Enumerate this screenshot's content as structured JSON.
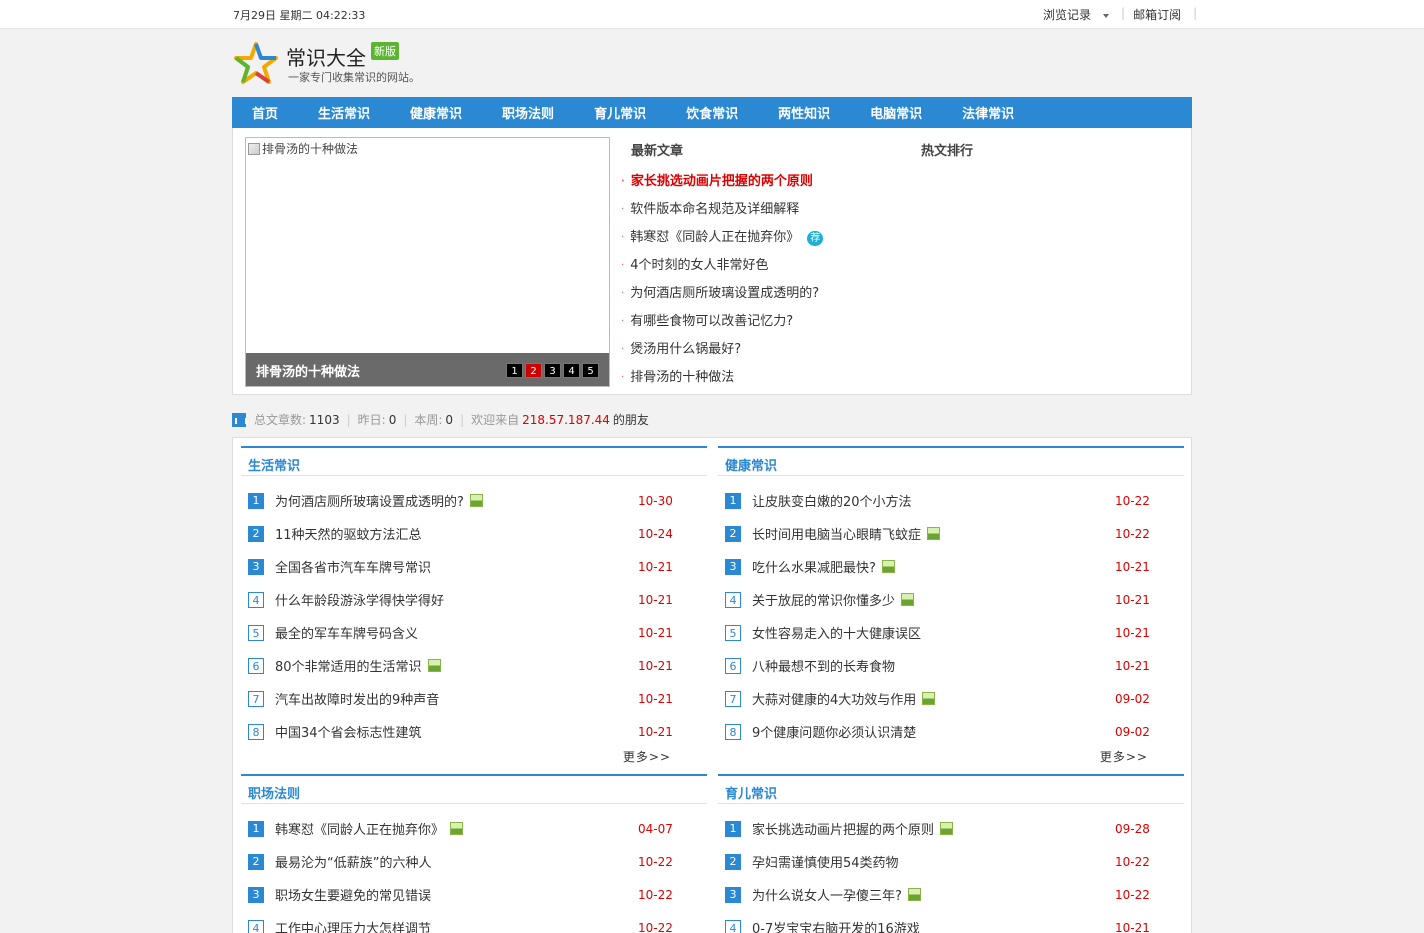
{
  "topbar": {
    "date": "7月29日  星期二  04:22:33",
    "history": "浏览记录",
    "subscribe": "邮箱订阅"
  },
  "logo": {
    "title": "常识大全",
    "badge": "新版",
    "subtitle": "一家专门收集常识的网站。"
  },
  "nav": [
    "首页",
    "生活常识",
    "健康常识",
    "职场法则",
    "育儿常识",
    "饮食常识",
    "两性知识",
    "电脑常识",
    "法律常识"
  ],
  "slider": {
    "image_alt": "排骨汤的十种做法",
    "caption": "排骨汤的十种做法",
    "pages": [
      "1",
      "2",
      "3",
      "4",
      "5"
    ],
    "active_page": 1
  },
  "latest": {
    "heading": "最新文章",
    "items": [
      "家长挑选动画片把握的两个原则",
      "软件版本命名规范及详细解释",
      "韩寒怼《同龄人正在抛弃你》",
      "4个时刻的女人非常好色",
      "为何酒店厕所玻璃设置成透明的?",
      "有哪些食物可以改善记忆力?",
      "煲汤用什么锅最好?",
      "排骨汤的十种做法"
    ],
    "tag": "荐"
  },
  "hotrank": {
    "heading": "热文排行"
  },
  "stats": {
    "total_label": "总文章数:",
    "total": "1103",
    "yesterday_label": "昨日:",
    "yesterday": "0",
    "week_label": "本周:",
    "week": "0",
    "welcome": "欢迎来自",
    "ip": "218.57.187.44",
    "friend": "的朋友"
  },
  "more_label": "更多>>",
  "sections": [
    {
      "title": "生活常识",
      "items": [
        {
          "n": "1",
          "text": "为何酒店厕所玻璃设置成透明的?",
          "date": "10-30",
          "pic": true
        },
        {
          "n": "2",
          "text": "11种天然的驱蚊方法汇总",
          "date": "10-24",
          "pic": false
        },
        {
          "n": "3",
          "text": "全国各省市汽车车牌号常识",
          "date": "10-21",
          "pic": false
        },
        {
          "n": "4",
          "text": "什么年龄段游泳学得快学得好",
          "date": "10-21",
          "pic": false
        },
        {
          "n": "5",
          "text": "最全的军车车牌号码含义",
          "date": "10-21",
          "pic": false
        },
        {
          "n": "6",
          "text": "80个非常适用的生活常识",
          "date": "10-21",
          "pic": true
        },
        {
          "n": "7",
          "text": "汽车出故障时发出的9种声音",
          "date": "10-21",
          "pic": false
        },
        {
          "n": "8",
          "text": "中国34个省会标志性建筑",
          "date": "10-21",
          "pic": false
        }
      ]
    },
    {
      "title": "健康常识",
      "items": [
        {
          "n": "1",
          "text": "让皮肤变白嫩的20个小方法",
          "date": "10-22",
          "pic": false
        },
        {
          "n": "2",
          "text": "长时间用电脑当心眼睛飞蚊症",
          "date": "10-22",
          "pic": true
        },
        {
          "n": "3",
          "text": "吃什么水果减肥最快?",
          "date": "10-21",
          "pic": true
        },
        {
          "n": "4",
          "text": "关于放屁的常识你懂多少",
          "date": "10-21",
          "pic": true
        },
        {
          "n": "5",
          "text": "女性容易走入的十大健康误区",
          "date": "10-21",
          "pic": false
        },
        {
          "n": "6",
          "text": "八种最想不到的长寿食物",
          "date": "10-21",
          "pic": false
        },
        {
          "n": "7",
          "text": "大蒜对健康的4大功效与作用",
          "date": "09-02",
          "pic": true
        },
        {
          "n": "8",
          "text": "9个健康问题你必须认识清楚",
          "date": "09-02",
          "pic": false
        }
      ]
    },
    {
      "title": "职场法则",
      "items": [
        {
          "n": "1",
          "text": "韩寒怼《同龄人正在抛弃你》",
          "date": "04-07",
          "pic": true
        },
        {
          "n": "2",
          "text": "最易沦为“低薪族”的六种人",
          "date": "10-22",
          "pic": false
        },
        {
          "n": "3",
          "text": "职场女生要避免的常见错误",
          "date": "10-22",
          "pic": false
        },
        {
          "n": "4",
          "text": "工作中心理压力大怎样调节",
          "date": "10-22",
          "pic": false
        }
      ]
    },
    {
      "title": "育儿常识",
      "items": [
        {
          "n": "1",
          "text": "家长挑选动画片把握的两个原则",
          "date": "09-28",
          "pic": true
        },
        {
          "n": "2",
          "text": "孕妇需谨慎使用54类药物",
          "date": "10-22",
          "pic": false
        },
        {
          "n": "3",
          "text": "为什么说女人一孕傻三年?",
          "date": "10-22",
          "pic": true
        },
        {
          "n": "4",
          "text": "0-7岁宝宝右脑开发的16游戏",
          "date": "10-21",
          "pic": false
        }
      ]
    }
  ]
}
